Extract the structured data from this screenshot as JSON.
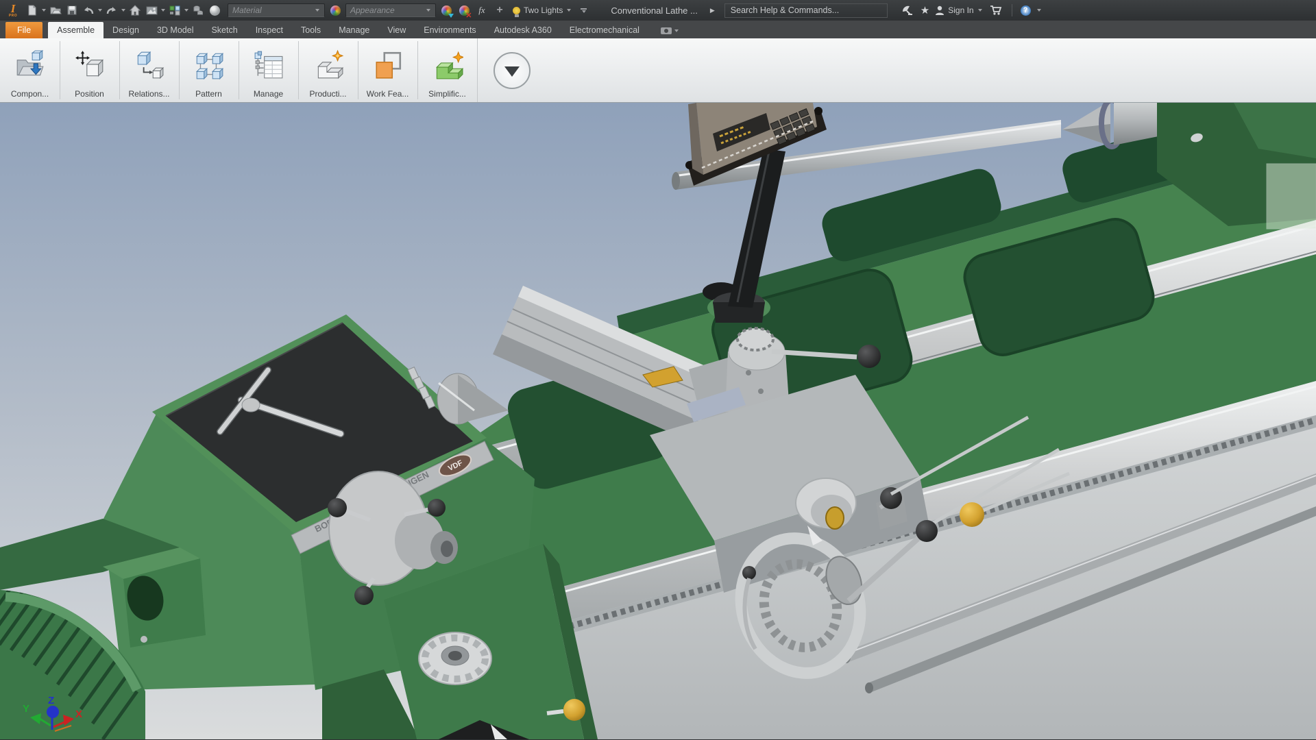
{
  "titlebar": {
    "logo_letter": "I",
    "logo_badge": "PRO",
    "material_placeholder": "Material",
    "appearance_placeholder": "Appearance",
    "fx_label": "fx",
    "plus_label": "+",
    "lights_label": "Two Lights",
    "document_title": "Conventional Lathe ...",
    "flyout_arrow": "▶",
    "search_placeholder": "Search Help & Commands...",
    "star_glyph": "★",
    "sign_in_label": "Sign In",
    "help_glyph": "?"
  },
  "ribbon": {
    "tabs": [
      {
        "label": "File"
      },
      {
        "label": "Assemble"
      },
      {
        "label": "Design"
      },
      {
        "label": "3D Model"
      },
      {
        "label": "Sketch"
      },
      {
        "label": "Inspect"
      },
      {
        "label": "Tools"
      },
      {
        "label": "Manage"
      },
      {
        "label": "View"
      },
      {
        "label": "Environments"
      },
      {
        "label": "Autodesk A360"
      },
      {
        "label": "Electromechanical"
      }
    ],
    "active_tab": "Assemble",
    "buttons": [
      {
        "label": "Compon...",
        "icon": "place-component"
      },
      {
        "label": "Position",
        "icon": "free-move"
      },
      {
        "label": "Relations...",
        "icon": "relationships"
      },
      {
        "label": "Pattern",
        "icon": "pattern-component"
      },
      {
        "label": "Manage",
        "icon": "bill-of-materials"
      },
      {
        "label": "Producti...",
        "icon": "production"
      },
      {
        "label": "Work Fea...",
        "icon": "work-features"
      },
      {
        "label": "Simplific...",
        "icon": "simplification"
      }
    ]
  },
  "viewport": {
    "model_name": "Conventional Lathe",
    "nameplate": {
      "brand": "BOEHRINGER",
      "city": "GÖPPINGEN",
      "badge": "VDF"
    },
    "triad": {
      "x": "X",
      "y": "Y",
      "z": "Z"
    },
    "colors": {
      "machine_green": "#3f7c4b",
      "machine_green_dark": "#2c5f3a",
      "recess_green": "#1e4a2e",
      "way_gray": "#c7c9ca",
      "sky_top": "#8fa1ba",
      "sky_bottom": "#d9dbdc",
      "gold": "#d2a12f",
      "graphite": "#1f2022"
    }
  }
}
